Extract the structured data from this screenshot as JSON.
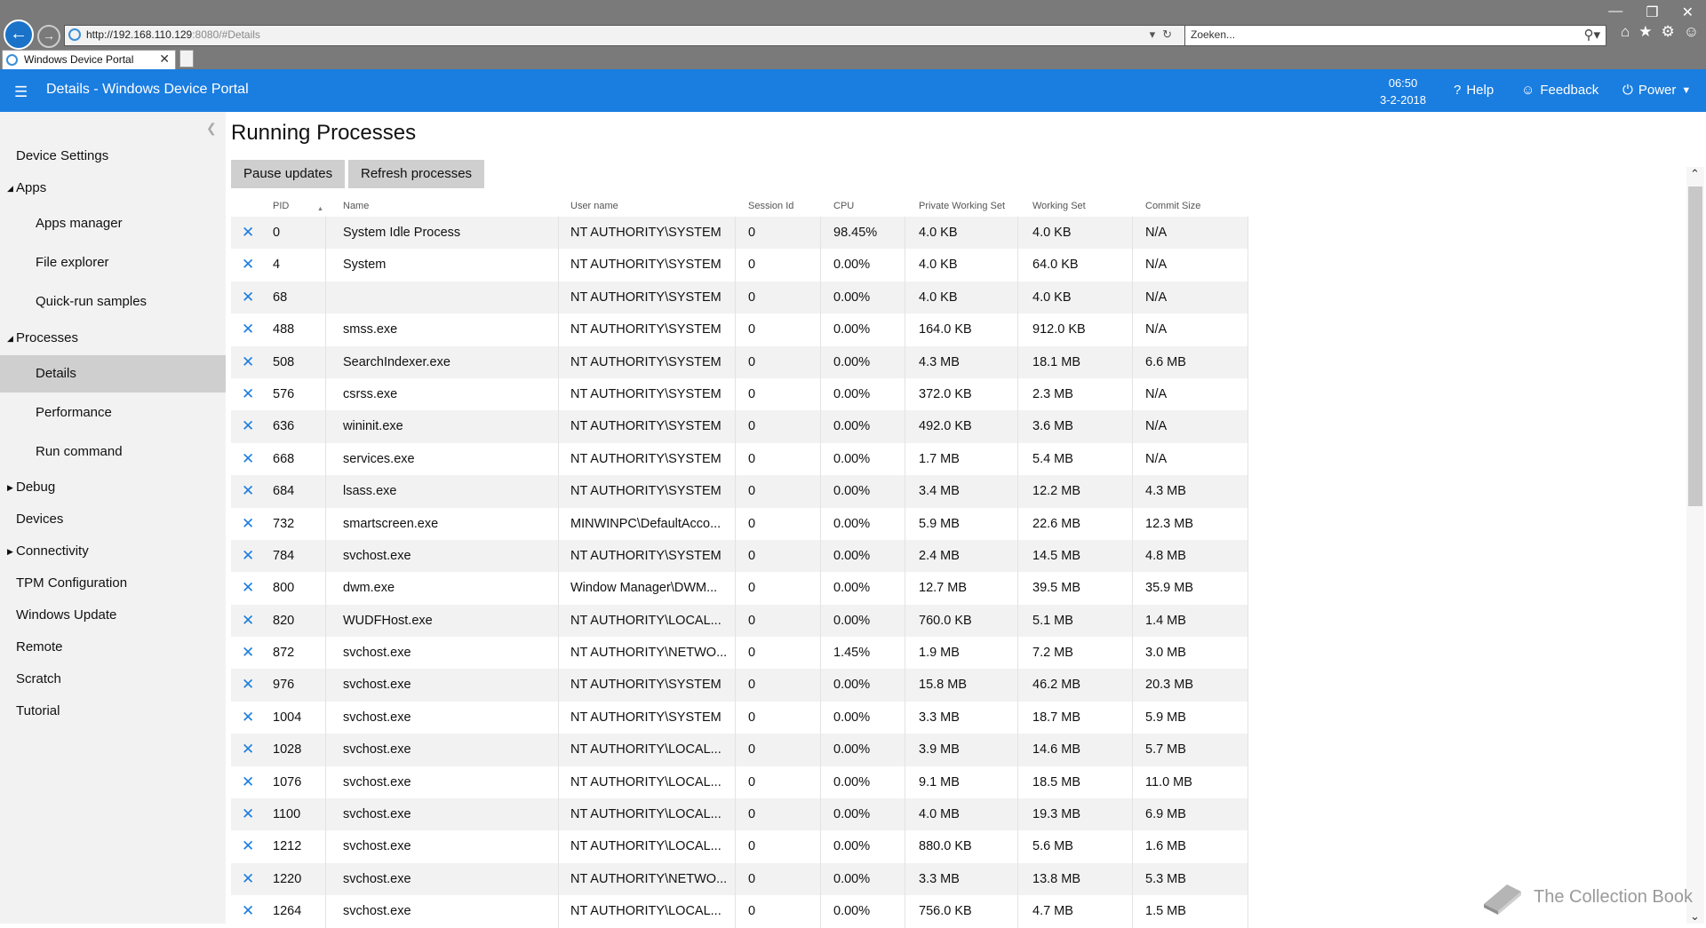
{
  "browser": {
    "url_host": "http://192.168.110.129",
    "url_rest": ":8080/#Details",
    "search_placeholder": "Zoeken...",
    "tab_title": "Windows Device Portal"
  },
  "header": {
    "title": "Details - Windows Device Portal",
    "time": "06:50",
    "date": "3-2-2018",
    "help": "Help",
    "feedback": "Feedback",
    "power": "Power"
  },
  "sidebar": {
    "device_settings": "Device Settings",
    "apps": "Apps",
    "apps_manager": "Apps manager",
    "file_explorer": "File explorer",
    "quick_run": "Quick-run samples",
    "processes": "Processes",
    "details": "Details",
    "performance": "Performance",
    "run_command": "Run command",
    "debug": "Debug",
    "devices": "Devices",
    "connectivity": "Connectivity",
    "tpm": "TPM Configuration",
    "windows_update": "Windows Update",
    "remote": "Remote",
    "scratch": "Scratch",
    "tutorial": "Tutorial"
  },
  "main": {
    "title": "Running Processes",
    "pause_button": "Pause updates",
    "refresh_button": "Refresh processes",
    "columns": [
      "PID",
      "Name",
      "User name",
      "Session Id",
      "CPU",
      "Private Working Set",
      "Working Set",
      "Commit Size"
    ],
    "rows": [
      [
        "0",
        "System Idle Process",
        "NT AUTHORITY\\SYSTEM",
        "0",
        "98.45%",
        "4.0 KB",
        "4.0 KB",
        "N/A"
      ],
      [
        "4",
        "System",
        "NT AUTHORITY\\SYSTEM",
        "0",
        "0.00%",
        "4.0 KB",
        "64.0 KB",
        "N/A"
      ],
      [
        "68",
        "",
        "NT AUTHORITY\\SYSTEM",
        "0",
        "0.00%",
        "4.0 KB",
        "4.0 KB",
        "N/A"
      ],
      [
        "488",
        "smss.exe",
        "NT AUTHORITY\\SYSTEM",
        "0",
        "0.00%",
        "164.0 KB",
        "912.0 KB",
        "N/A"
      ],
      [
        "508",
        "SearchIndexer.exe",
        "NT AUTHORITY\\SYSTEM",
        "0",
        "0.00%",
        "4.3 MB",
        "18.1 MB",
        "6.6 MB"
      ],
      [
        "576",
        "csrss.exe",
        "NT AUTHORITY\\SYSTEM",
        "0",
        "0.00%",
        "372.0 KB",
        "2.3 MB",
        "N/A"
      ],
      [
        "636",
        "wininit.exe",
        "NT AUTHORITY\\SYSTEM",
        "0",
        "0.00%",
        "492.0 KB",
        "3.6 MB",
        "N/A"
      ],
      [
        "668",
        "services.exe",
        "NT AUTHORITY\\SYSTEM",
        "0",
        "0.00%",
        "1.7 MB",
        "5.4 MB",
        "N/A"
      ],
      [
        "684",
        "lsass.exe",
        "NT AUTHORITY\\SYSTEM",
        "0",
        "0.00%",
        "3.4 MB",
        "12.2 MB",
        "4.3 MB"
      ],
      [
        "732",
        "smartscreen.exe",
        "MINWINPC\\DefaultAcco...",
        "0",
        "0.00%",
        "5.9 MB",
        "22.6 MB",
        "12.3 MB"
      ],
      [
        "784",
        "svchost.exe",
        "NT AUTHORITY\\SYSTEM",
        "0",
        "0.00%",
        "2.4 MB",
        "14.5 MB",
        "4.8 MB"
      ],
      [
        "800",
        "dwm.exe",
        "Window Manager\\DWM...",
        "0",
        "0.00%",
        "12.7 MB",
        "39.5 MB",
        "35.9 MB"
      ],
      [
        "820",
        "WUDFHost.exe",
        "NT AUTHORITY\\LOCAL...",
        "0",
        "0.00%",
        "760.0 KB",
        "5.1 MB",
        "1.4 MB"
      ],
      [
        "872",
        "svchost.exe",
        "NT AUTHORITY\\NETWO...",
        "0",
        "1.45%",
        "1.9 MB",
        "7.2 MB",
        "3.0 MB"
      ],
      [
        "976",
        "svchost.exe",
        "NT AUTHORITY\\SYSTEM",
        "0",
        "0.00%",
        "15.8 MB",
        "46.2 MB",
        "20.3 MB"
      ],
      [
        "1004",
        "svchost.exe",
        "NT AUTHORITY\\SYSTEM",
        "0",
        "0.00%",
        "3.3 MB",
        "18.7 MB",
        "5.9 MB"
      ],
      [
        "1028",
        "svchost.exe",
        "NT AUTHORITY\\LOCAL...",
        "0",
        "0.00%",
        "3.9 MB",
        "14.6 MB",
        "5.7 MB"
      ],
      [
        "1076",
        "svchost.exe",
        "NT AUTHORITY\\LOCAL...",
        "0",
        "0.00%",
        "9.1 MB",
        "18.5 MB",
        "11.0 MB"
      ],
      [
        "1100",
        "svchost.exe",
        "NT AUTHORITY\\LOCAL...",
        "0",
        "0.00%",
        "4.0 MB",
        "19.3 MB",
        "6.9 MB"
      ],
      [
        "1212",
        "svchost.exe",
        "NT AUTHORITY\\LOCAL...",
        "0",
        "0.00%",
        "880.0 KB",
        "5.6 MB",
        "1.6 MB"
      ],
      [
        "1220",
        "svchost.exe",
        "NT AUTHORITY\\NETWO...",
        "0",
        "0.00%",
        "3.3 MB",
        "13.8 MB",
        "5.3 MB"
      ],
      [
        "1264",
        "svchost.exe",
        "NT AUTHORITY\\LOCAL...",
        "0",
        "0.00%",
        "756.0 KB",
        "4.7 MB",
        "1.5 MB"
      ]
    ]
  },
  "watermark": "The Collection Book",
  "colors": {
    "accent": "#1a7de0",
    "sidebar_bg": "#f2f2f2",
    "row_alt": "#f2f2f2",
    "active_nav": "#cfcfcf"
  }
}
